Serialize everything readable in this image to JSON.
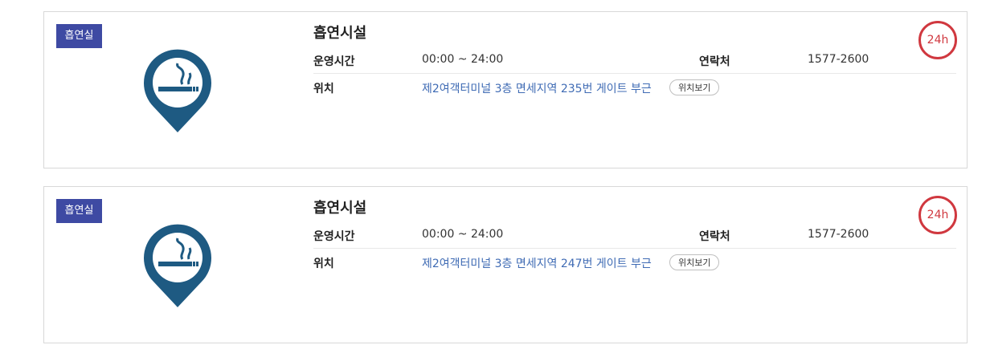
{
  "facilities": [
    {
      "badge": "흡연실",
      "title": "흡연시설",
      "hours_label": "운영시간",
      "hours_value": "00:00 ~ 24:00",
      "contact_label": "연락처",
      "contact_value": "1577-2600",
      "location_label": "위치",
      "location_value": "제2여객터미널 3층 면세지역 235번 게이트 부근",
      "map_button": "위치보기",
      "hours_badge": "24h",
      "icon": "smoking-area-pin-icon"
    },
    {
      "badge": "흡연실",
      "title": "흡연시설",
      "hours_label": "운영시간",
      "hours_value": "00:00 ~ 24:00",
      "contact_label": "연락처",
      "contact_value": "1577-2600",
      "location_label": "위치",
      "location_value": "제2여객터미널 3층 면세지역 247번 게이트 부근",
      "map_button": "위치보기",
      "hours_badge": "24h",
      "icon": "smoking-area-pin-icon"
    }
  ],
  "colors": {
    "badge_bg": "#3e4aa3",
    "pin": "#1e5a82",
    "link": "#3f6bb4",
    "hours_badge": "#d0383f"
  }
}
